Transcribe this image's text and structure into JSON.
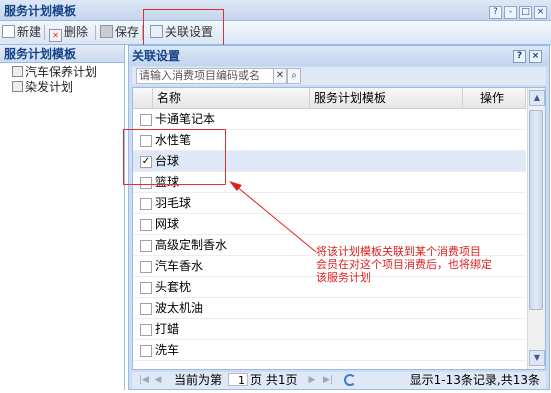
{
  "window": {
    "title": "服务计划模板",
    "buttons": [
      "?",
      "-",
      "□",
      "×"
    ]
  },
  "toolbar": {
    "new_label": "新建",
    "delete_label": "删除",
    "save_label": "保存",
    "link_settings_label": "关联设置"
  },
  "left_panel": {
    "title": "服务计划模板",
    "items": [
      {
        "label": "汽车保养计划"
      },
      {
        "label": "染发计划"
      }
    ]
  },
  "dialog": {
    "title": "关联设置",
    "buttons": [
      "?",
      "×"
    ],
    "search": {
      "placeholder": "请输入消费项目编码或名",
      "value": "请输入消费项目编码或名"
    },
    "grid": {
      "columns": [
        "名称",
        "服务计划模板",
        "操作"
      ],
      "rows": [
        {
          "name": "卡通笔记本",
          "checked": false
        },
        {
          "name": "水性笔",
          "checked": false
        },
        {
          "name": "台球",
          "checked": true
        },
        {
          "name": "篮球",
          "checked": false
        },
        {
          "name": "羽毛球",
          "checked": false
        },
        {
          "name": "网球",
          "checked": false
        },
        {
          "name": "高级定制香水",
          "checked": false
        },
        {
          "name": "汽车香水",
          "checked": false
        },
        {
          "name": "头套枕",
          "checked": false
        },
        {
          "name": "波太机油",
          "checked": false
        },
        {
          "name": "打蜡",
          "checked": false
        },
        {
          "name": "洗车",
          "checked": false
        }
      ]
    },
    "paging": {
      "current_prefix": "当前为第",
      "page_value": "1",
      "page_suffix": "页 共1页",
      "summary": "显示1-13条记录,共13条"
    }
  },
  "annotation": {
    "lines": [
      "将该计划模板关联到某个消费项目",
      "会员在对这个项目消费后，也将绑定",
      "该服务计划"
    ],
    "color": "#e02020"
  }
}
